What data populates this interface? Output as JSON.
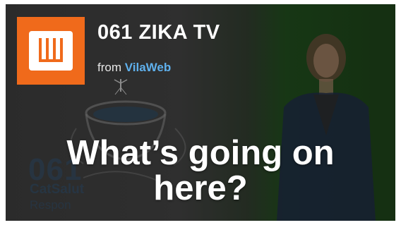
{
  "video": {
    "channel_title": "061 ZIKA TV",
    "from_prefix": "from",
    "from_name": "VilaWeb",
    "headline_line1": "What’s going on",
    "headline_line2": "here?",
    "background_brand": {
      "number": "061",
      "name": "CatSalut",
      "sub": "Respon"
    }
  },
  "colors": {
    "logo_bg": "#f06a1b",
    "link": "#5fb0ec",
    "green_screen": "#1f4a1c"
  },
  "icons": [
    "channel-logo-icon",
    "mosquito-icon"
  ]
}
